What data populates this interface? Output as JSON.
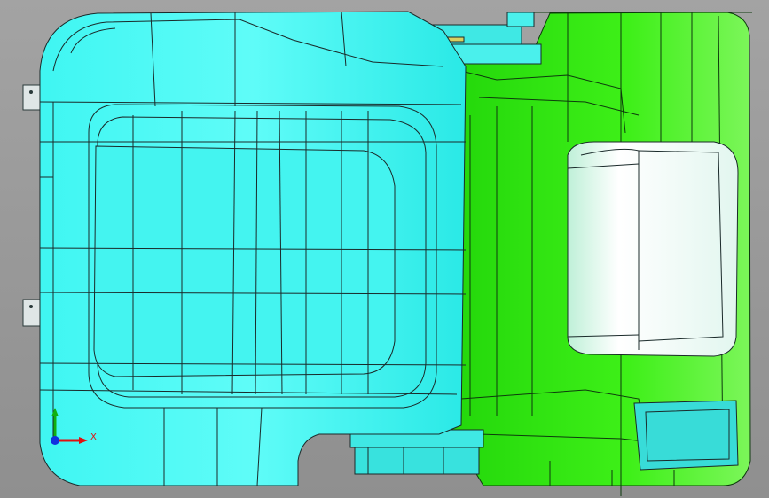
{
  "viewport": {
    "background": "#9a9a9a"
  },
  "model": {
    "cushion_color": "#2ff2ef",
    "back_color": "#2ee60c",
    "pad_color": "#e9f7f0"
  },
  "triad": {
    "x_label": "X",
    "x_color": "#e01010",
    "y_color": "#10b010",
    "z_color": "#1030e0"
  }
}
